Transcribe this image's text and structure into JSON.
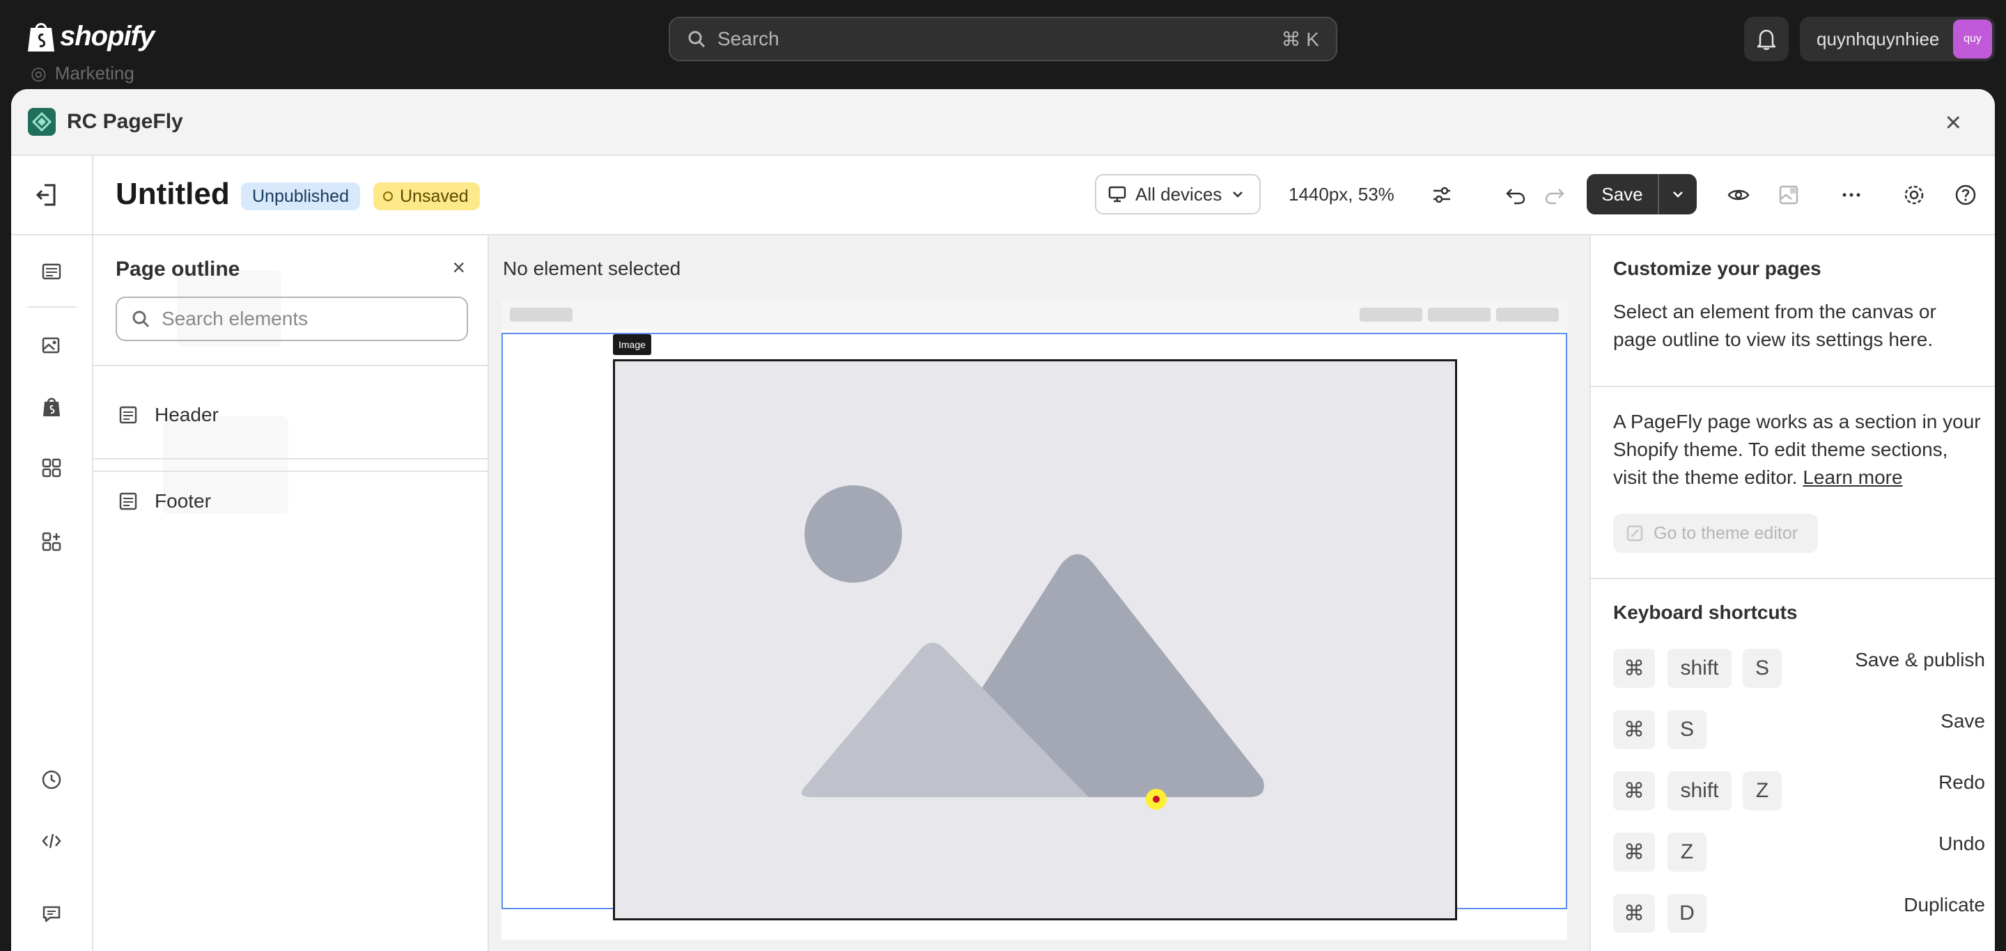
{
  "shopify": {
    "logo_text": "shopify",
    "search_placeholder": "Search",
    "search_shortcut": "⌘ K",
    "username": "quynhquynhiee",
    "avatar_initials": "quy",
    "ghost_nav_item": "Marketing"
  },
  "modal": {
    "app_name": "RC PageFly",
    "close_icon": "×"
  },
  "toolbar": {
    "page_title": "Untitled",
    "status_badge": "Unpublished",
    "unsaved_badge": "Unsaved",
    "device_select": "All devices",
    "viewport": "1440px, 53%",
    "save_label": "Save"
  },
  "rail": {
    "icons": [
      "exit-icon",
      "layers-icon",
      "image-icon",
      "shopify-icon",
      "elements-icon",
      "add-section-icon",
      "history-icon",
      "code-icon",
      "chat-icon"
    ]
  },
  "outline": {
    "title": "Page outline",
    "close": "×",
    "search_placeholder": "Search elements",
    "items": [
      {
        "label": "Header",
        "icon": "section-icon"
      },
      {
        "label": "Footer",
        "icon": "section-icon"
      }
    ]
  },
  "canvas": {
    "status": "No element selected",
    "selected_label": "Image"
  },
  "settings": {
    "title": "Customize your pages",
    "intro": "Select an element from the canvas or page outline to view its settings here.",
    "info": "A PageFly page works as a section in your Shopify theme. To edit theme sections, visit the theme editor.",
    "learn_more": "Learn more",
    "theme_button": "Go to theme editor",
    "shortcuts_title": "Keyboard shortcuts",
    "shortcuts": [
      {
        "keys": [
          "⌘",
          "shift",
          "S"
        ],
        "label": "Save & publish"
      },
      {
        "keys": [
          "⌘",
          "S"
        ],
        "label": "Save"
      },
      {
        "keys": [
          "⌘",
          "shift",
          "Z"
        ],
        "label": "Redo"
      },
      {
        "keys": [
          "⌘",
          "Z"
        ],
        "label": "Undo"
      },
      {
        "keys": [
          "⌘",
          "D"
        ],
        "label": "Duplicate"
      }
    ]
  },
  "colors": {
    "topbar": "#1a1a1a",
    "selection": "#5b8def",
    "unpublished_badge": "#d7e9fb",
    "unsaved_badge": "#fde98a"
  }
}
